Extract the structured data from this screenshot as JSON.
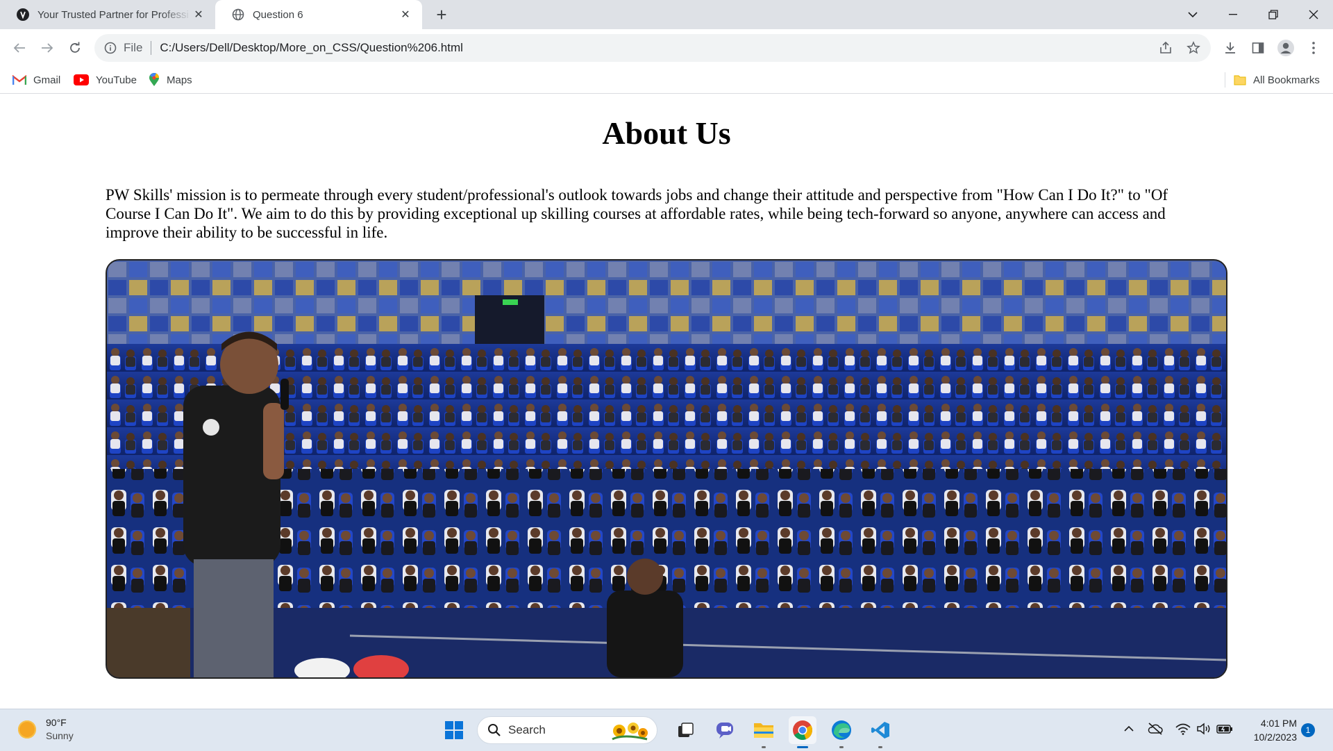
{
  "browser": {
    "tabs": [
      {
        "title": "Your Trusted Partner for Professi",
        "favicon": "circle-logo-icon",
        "active": false
      },
      {
        "title": "Question 6",
        "favicon": "globe-icon",
        "active": true
      }
    ],
    "address": {
      "scheme": "File",
      "url": "C:/Users/Dell/Desktop/More_on_CSS/Question%206.html"
    },
    "bookmarks": [
      {
        "label": "Gmail",
        "icon": "gmail-icon"
      },
      {
        "label": "YouTube",
        "icon": "youtube-icon"
      },
      {
        "label": "Maps",
        "icon": "maps-pin-icon"
      }
    ],
    "all_bookmarks": "All Bookmarks"
  },
  "page": {
    "heading": "About Us",
    "mission": "PW Skills' mission is to permeate through every student/professional's outlook towards jobs and change their attitude and perspective from \"How Can I Do It?\" to \"Of Course I Can Do It\". We aim to do this by providing exceptional up skilling courses at affordable rates, while being tech-forward so anyone, anywhere can access and improve their ability to be successful in life."
  },
  "taskbar": {
    "weather": {
      "temp": "90°F",
      "condition": "Sunny"
    },
    "search_label": "Search",
    "clock": {
      "time": "4:01 PM",
      "date": "10/2/2023"
    },
    "notification_count": "1"
  },
  "colors": {
    "tabstrip": "#dee1e6",
    "taskbar": "#dfe7f1",
    "accent": "#0067c0"
  }
}
